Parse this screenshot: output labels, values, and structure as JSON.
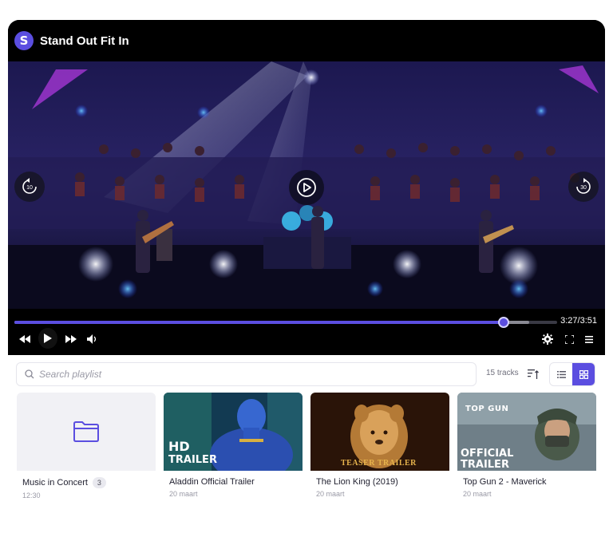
{
  "app": {
    "logo_letter": "S",
    "title": "Stand Out Fit In"
  },
  "player": {
    "skip_back_seconds": "10",
    "skip_forward_seconds": "30",
    "time": "3:27/3:51",
    "progress": 0.901,
    "buffered": 0.948
  },
  "playlist": {
    "search_placeholder": "Search playlist",
    "track_count": "15 tracks",
    "view": "grid"
  },
  "items": [
    {
      "title": "Music in Concert",
      "badge": "3",
      "subtitle": "12:30",
      "type": "folder"
    },
    {
      "title": "Aladdin Official Trailer",
      "subtitle": "20 maart",
      "thumb_text": [
        "HD",
        "TRAILER"
      ]
    },
    {
      "title": "The Lion King (2019)",
      "subtitle": "20 maart",
      "thumb_text": [
        "TEASER TRAILER"
      ]
    },
    {
      "title": "Top Gun 2 - Maverick",
      "subtitle": "20 maart",
      "thumb_text": [
        "OFFICIAL",
        "TRAILER",
        "TOP GUN"
      ]
    }
  ],
  "colors": {
    "accent": "#5b4ee0",
    "background": "#ffffff",
    "player_bg": "#000000"
  }
}
